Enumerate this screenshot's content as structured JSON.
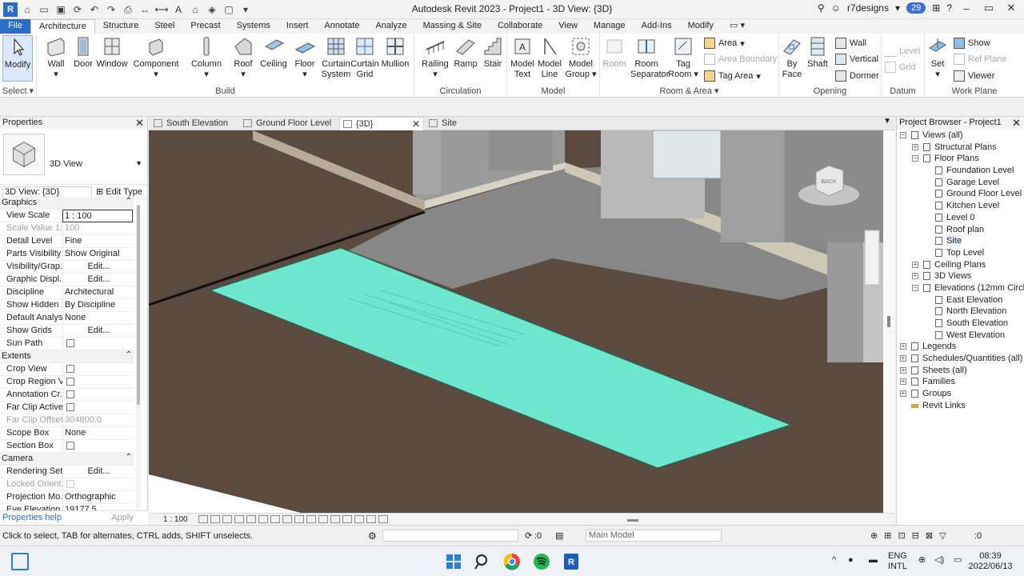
{
  "window": {
    "title": "Autodesk Revit 2023 - Project1 - 3D View: {3D}",
    "user": "r7designs",
    "notif_count": "29"
  },
  "tabs": [
    "File",
    "Architecture",
    "Structure",
    "Steel",
    "Precast",
    "Systems",
    "Insert",
    "Annotate",
    "Analyze",
    "Massing & Site",
    "Collaborate",
    "View",
    "Manage",
    "Add-Ins",
    "Modify"
  ],
  "ribbon": {
    "select": {
      "modify": "Modify",
      "select_label": "Select"
    },
    "build": {
      "label": "Build",
      "wall": "Wall",
      "door": "Door",
      "window": "Window",
      "component": "Component",
      "column": "Column",
      "roof": "Roof",
      "ceiling": "Ceiling",
      "floor": "Floor",
      "curtain_system_1": "Curtain",
      "curtain_system_2": "System",
      "curtain_grid_1": "Curtain",
      "curtain_grid_2": "Grid",
      "mullion": "Mullion"
    },
    "circulation": {
      "label": "Circulation",
      "railing": "Railing",
      "ramp": "Ramp",
      "stair": "Stair"
    },
    "model": {
      "label": "Model",
      "text_1": "Model",
      "text_2": "Text",
      "line_1": "Model",
      "line_2": "Line",
      "group_1": "Model",
      "group_2": "Group"
    },
    "room_area": {
      "label": "Room & Area",
      "room": "Room",
      "separator_1": "Room",
      "separator_2": "Separator",
      "tag_room_1": "Tag",
      "tag_room_2": "Room",
      "area": "Area",
      "area_boundary": "Area  Boundary",
      "tag_area": "Tag  Area"
    },
    "opening": {
      "label": "Opening",
      "by_face_1": "By",
      "by_face_2": "Face",
      "shaft": "Shaft",
      "wall": "Wall",
      "vertical": "Vertical",
      "dormer": "Dormer"
    },
    "datum": {
      "label": "Datum",
      "level": "Level",
      "grid": "Grid"
    },
    "work_plane": {
      "label": "Work Plane",
      "set": "Set",
      "show": "Show",
      "ref_plane": "Ref  Plane",
      "viewer": "Viewer"
    }
  },
  "properties": {
    "header": "Properties",
    "type_name": "3D View",
    "instance": "3D View: {3D}",
    "edit_type": "Edit Type",
    "sections": {
      "graphics": "Graphics",
      "extents": "Extents",
      "camera": "Camera"
    },
    "graphics_rows": [
      {
        "name": "View Scale",
        "value": "1 : 100"
      },
      {
        "name": "Scale Value    1:",
        "value": "100"
      },
      {
        "name": "Detail Level",
        "value": "Fine"
      },
      {
        "name": "Parts Visibility",
        "value": "Show Original"
      },
      {
        "name": "Visibility/Grap...",
        "value": "Edit..."
      },
      {
        "name": "Graphic Displ...",
        "value": "Edit..."
      },
      {
        "name": "Discipline",
        "value": "Architectural"
      },
      {
        "name": "Show Hidden ...",
        "value": "By Discipline"
      },
      {
        "name": "Default Analys...",
        "value": "None"
      },
      {
        "name": "Show Grids",
        "value": "Edit..."
      },
      {
        "name": "Sun Path",
        "value": ""
      }
    ],
    "extents_rows": [
      {
        "name": "Crop View",
        "value": ""
      },
      {
        "name": "Crop Region V...",
        "value": ""
      },
      {
        "name": "Annotation Cr...",
        "value": ""
      },
      {
        "name": "Far Clip Active",
        "value": ""
      },
      {
        "name": "Far Clip Offset",
        "value": "304800.0"
      },
      {
        "name": "Scope Box",
        "value": "None"
      },
      {
        "name": "Section Box",
        "value": ""
      }
    ],
    "camera_rows": [
      {
        "name": "Rendering Set...",
        "value": "Edit..."
      },
      {
        "name": "Locked Orient...",
        "value": ""
      },
      {
        "name": "Projection Mo...",
        "value": "Orthographic"
      },
      {
        "name": "Eye Elevation",
        "value": "19177.5"
      }
    ],
    "help": "Properties help",
    "apply": "Apply"
  },
  "view_tabs": [
    {
      "label": "South Elevation"
    },
    {
      "label": "Ground Floor Level"
    },
    {
      "label": "{3D}"
    },
    {
      "label": "Site"
    }
  ],
  "view_bar": {
    "scale": "1 : 100"
  },
  "viewcube": {
    "face": "BACK"
  },
  "browser": {
    "header": "Project Browser - Project1",
    "views_all": "Views (all)",
    "structural_plans": "Structural Plans",
    "floor_plans": "Floor Plans",
    "floor_items": [
      "Foundation Level",
      "Garage Level",
      "Ground Floor Level",
      "Kitchen Level",
      "Level 0",
      "Roof plan",
      "Site",
      "Top Level"
    ],
    "ceiling_plans": "Ceiling Plans",
    "views_3d": "3D Views",
    "elevations": "Elevations (12mm Circle)",
    "elevation_items": [
      "East Elevation",
      "North Elevation",
      "South Elevation",
      "West Elevation"
    ],
    "legends": "Legends",
    "schedules": "Schedules/Quantities (all)",
    "sheets": "Sheets (all)",
    "families": "Families",
    "groups": "Groups",
    "revit_links": "Revit Links"
  },
  "status": {
    "message": "Click to select, TAB for alternates, CTRL adds, SHIFT unselects.",
    "zero_a": ":0",
    "model": "Main Model",
    "zero_b": ":0"
  },
  "taskbar": {
    "lang_1": "ENG",
    "lang_2": "INTL",
    "time": "08:39",
    "date": "2022/06/13"
  },
  "colors": {
    "accent": "#2b6cc4",
    "floor_selected": "#6de8cf",
    "ground": "#5b4a3f",
    "slab": "#8a8a8a",
    "wall": "#9a9a9a"
  }
}
